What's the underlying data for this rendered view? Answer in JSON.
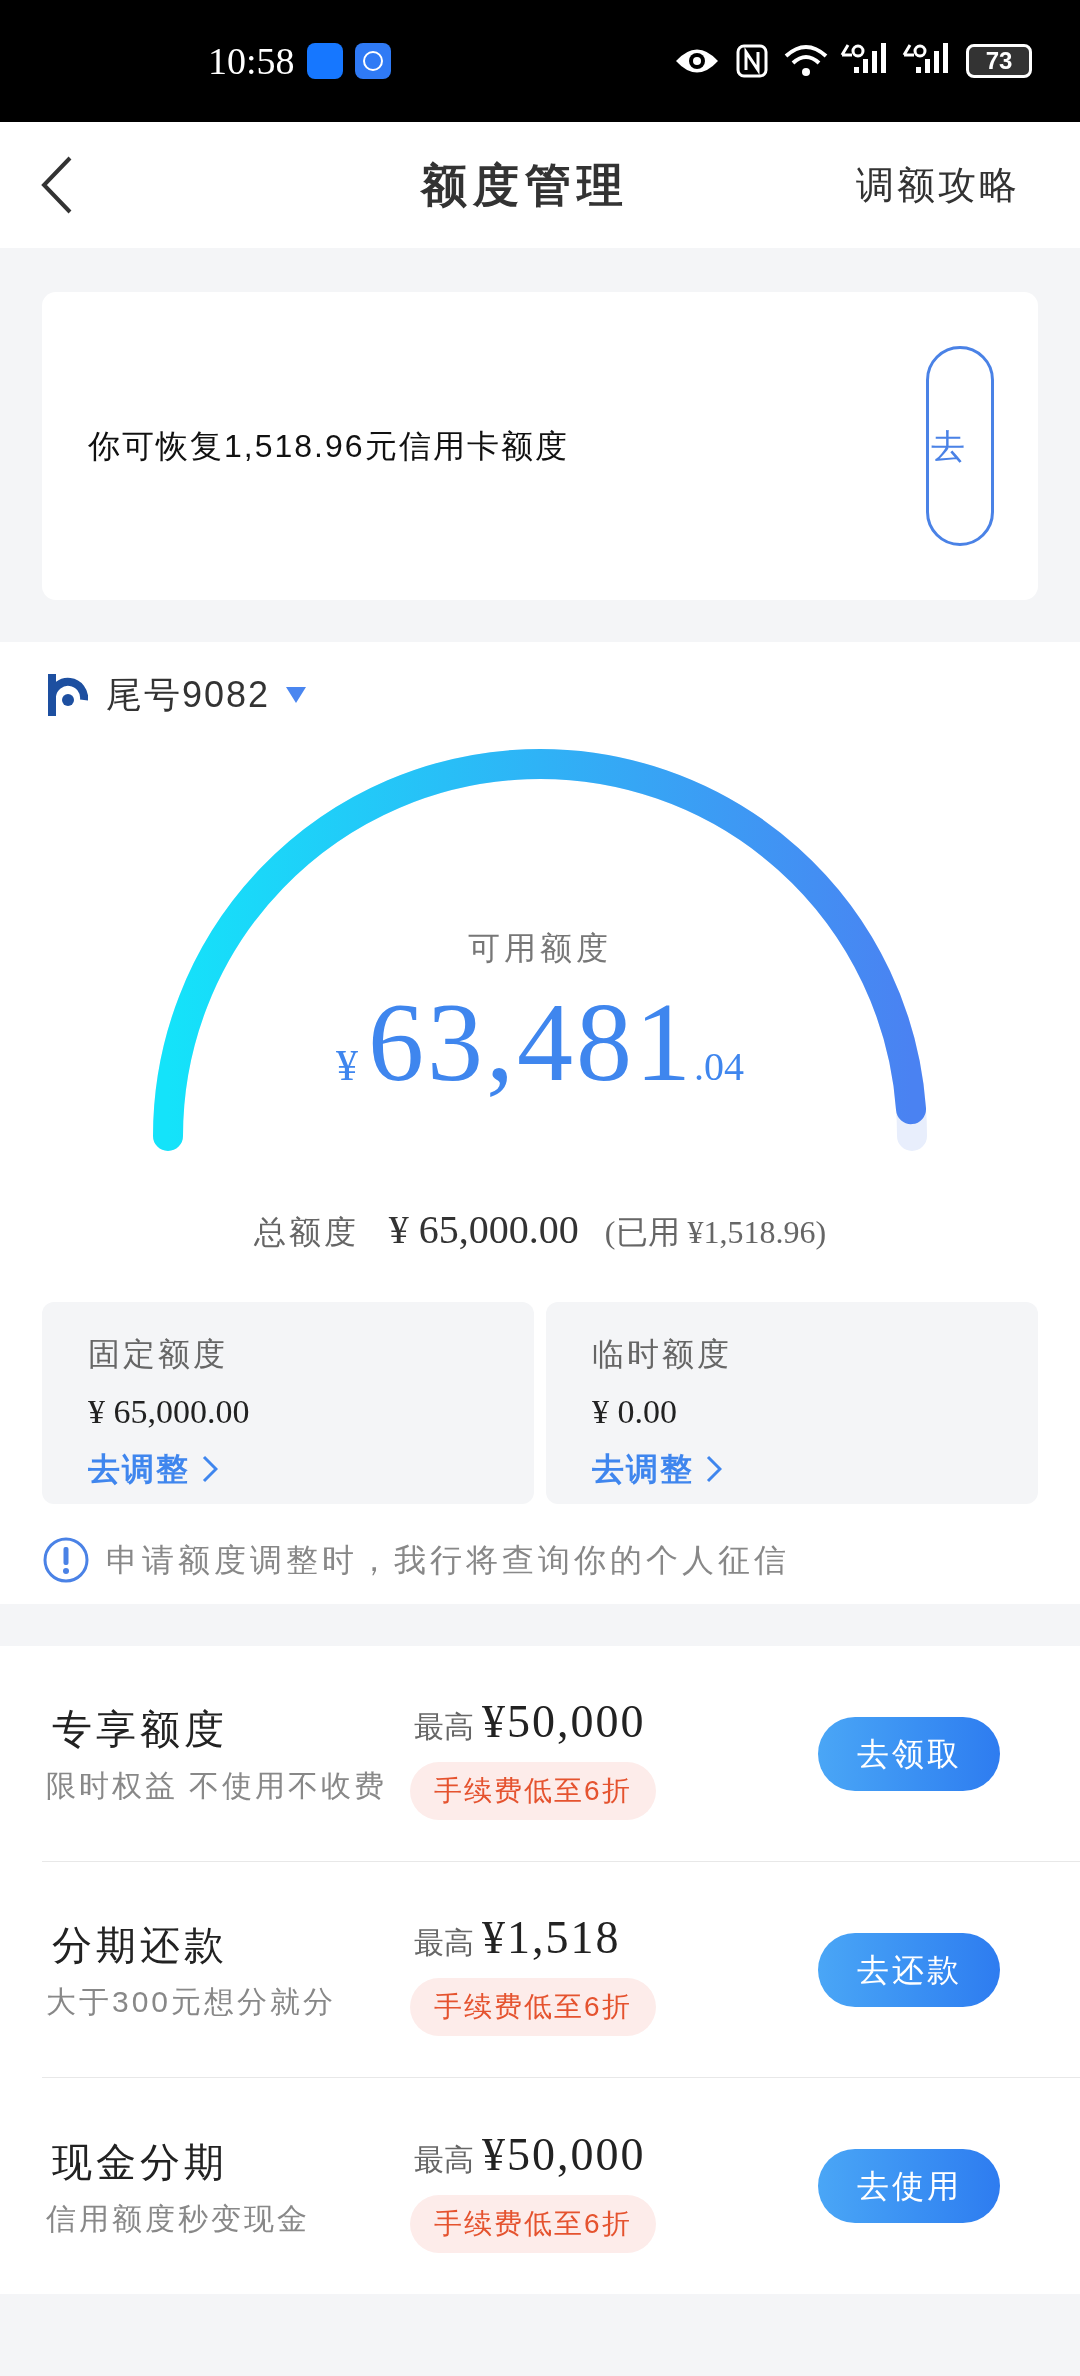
{
  "status_bar": {
    "time": "10:58",
    "battery": "73"
  },
  "header": {
    "title": "额度管理",
    "action": "调额攻略"
  },
  "restore_card": {
    "text": "你可恢复1,518.96元信用卡额度",
    "button": "去"
  },
  "card_selector": {
    "label": "尾号9082"
  },
  "gauge": {
    "level": 0.977,
    "label": "可用额度",
    "currency": "¥",
    "integer": "63,481",
    "decimal": ".04"
  },
  "total": {
    "label": "总额度",
    "amount": "¥ 65,000.00",
    "used": "(已用 ¥1,518.96)"
  },
  "limits": [
    {
      "title": "固定额度",
      "amount": "¥ 65,000.00",
      "link": "去调整"
    },
    {
      "title": "临时额度",
      "amount": "¥ 0.00",
      "link": "去调整"
    }
  ],
  "notice": "申请额度调整时，我行将查询你的个人征信",
  "offers": [
    {
      "title": "专享额度",
      "subtitle": "限时权益 不使用不收费",
      "prefix": "最高",
      "amount": "¥50,000",
      "tag": "手续费低至6折",
      "button": "去领取"
    },
    {
      "title": "分期还款",
      "subtitle": "大于300元想分就分",
      "prefix": "最高",
      "amount": "¥1,518",
      "tag": "手续费低至6折",
      "button": "去还款"
    },
    {
      "title": "现金分期",
      "subtitle": "信用额度秒变现金",
      "prefix": "最高",
      "amount": "¥50,000",
      "tag": "手续费低至6折",
      "button": "去使用"
    }
  ]
}
